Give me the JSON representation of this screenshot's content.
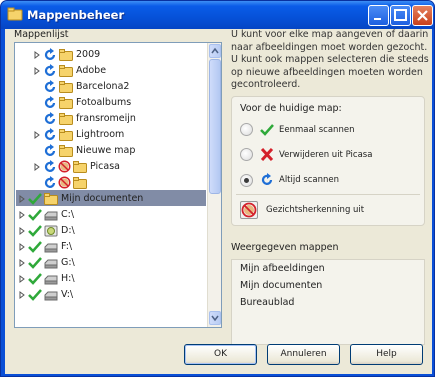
{
  "window": {
    "title": "Mappenbeheer"
  },
  "tree": {
    "label": "Mappenlijst",
    "items": [
      {
        "label": "2009",
        "state": "always",
        "expander": true,
        "folder": "yellow"
      },
      {
        "label": "Adobe",
        "state": "always",
        "expander": true,
        "folder": "yellow"
      },
      {
        "label": "Barcelona2",
        "state": "always",
        "expander": false,
        "folder": "yellow"
      },
      {
        "label": "Fotoalbums",
        "state": "always",
        "expander": false,
        "folder": "yellow"
      },
      {
        "label": "fransromeijn",
        "state": "always",
        "expander": false,
        "folder": "yellow"
      },
      {
        "label": "Lightroom",
        "state": "always",
        "expander": true,
        "folder": "yellow"
      },
      {
        "label": "Nieuwe map",
        "state": "always",
        "expander": false,
        "folder": "yellow"
      },
      {
        "label": "Picasa",
        "state": "no-face",
        "expander": true,
        "folder": "yellow"
      },
      {
        "label": "woonkamer",
        "state": "no-face",
        "expander": false,
        "folder": "yellow",
        "selected": true
      },
      {
        "label": "Mijn documenten",
        "state": "once",
        "expander": true,
        "folder": "yellow"
      },
      {
        "label": "C:\\",
        "state": "once",
        "expander": true,
        "folder": "drive"
      },
      {
        "label": "D:\\",
        "state": "once",
        "expander": true,
        "folder": "drive-cd"
      },
      {
        "label": "F:\\",
        "state": "once",
        "expander": true,
        "folder": "drive"
      },
      {
        "label": "G:\\",
        "state": "once",
        "expander": true,
        "folder": "drive"
      },
      {
        "label": "H:\\",
        "state": "once",
        "expander": true,
        "folder": "drive"
      },
      {
        "label": "V:\\",
        "state": "once",
        "expander": true,
        "folder": "drive"
      }
    ]
  },
  "info": {
    "text": "U kunt voor elke map aangeven of daarin naar afbeeldingen moet worden gezocht. U kunt ook mappen selecteren die steeds op nieuwe afbeeldingen moeten worden gecontroleerd."
  },
  "mode": {
    "title": "Voor de huidige map:",
    "options": [
      {
        "label": "Eenmaal scannen",
        "icon": "check-icon",
        "checked": false
      },
      {
        "label": "Verwijderen uit Picasa",
        "icon": "red-x-icon",
        "checked": false
      },
      {
        "label": "Altijd scannen",
        "icon": "refresh-icon",
        "checked": true
      }
    ],
    "face_label": "Gezichtsherkenning uit"
  },
  "shown": {
    "label": "Weergegeven mappen",
    "items": [
      "Mijn afbeeldingen",
      "Mijn documenten",
      "Bureaublad"
    ]
  },
  "buttons": {
    "ok": "OK",
    "cancel": "Annuleren",
    "help": "Help"
  },
  "colors": {
    "title_bar": "#0a5ce8",
    "selection": "#818ca6",
    "dialog_bg": "#ece9d8"
  }
}
